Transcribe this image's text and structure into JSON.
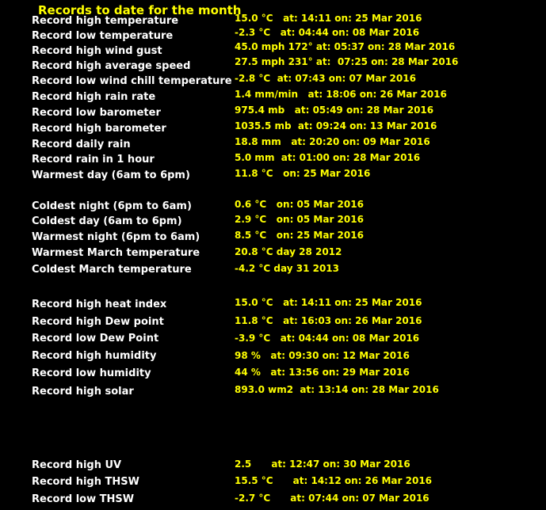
{
  "title": "Records to date for the month",
  "records": [
    {
      "label": "Record high temperature",
      "value": "15.0 °C   at: 14:11 on: 25 Mar 2016"
    },
    {
      "label": "Record low temperature",
      "value": "-2.3 °C   at: 04:44 on: 08 Mar 2016"
    },
    {
      "label": "Record high wind gust",
      "value": "45.0 mph 172° at: 05:37 on: 28 Mar 2016"
    },
    {
      "label": "Record high average speed",
      "value": "27.5 mph 231° at:  07:25 on: 28 Mar 2016"
    },
    {
      "label": "Record low wind chill temperature",
      "value": "-2.8 °C  at: 07:43 on: 07 Mar 2016"
    },
    {
      "label": "Record high rain rate",
      "value": "1.4 mm/min   at: 18:06 on: 26 Mar 2016"
    },
    {
      "label": "Record low barometer",
      "value": "975.4 mb   at: 05:49 on: 28 Mar 2016"
    },
    {
      "label": "Record high barometer",
      "value": "1035.5 mb  at: 09:24 on: 13 Mar 2016"
    },
    {
      "label": "Record daily rain",
      "value": "18.8 mm   at: 20:20 on: 09 Mar 2016"
    },
    {
      "label": "Record rain in 1 hour",
      "value": "5.0 mm  at: 01:00 on: 28 Mar 2016"
    },
    {
      "label": "Warmest day (6am to 6pm)",
      "value": "11.8 °C   on: 25 Mar 2016"
    },
    {
      "label": "Coldest night (6pm to 6am)",
      "value": "0.6 °C   on: 05 Mar 2016"
    },
    {
      "label": "Coldest day (6am to 6pm)",
      "value": "2.9 °C   on: 05 Mar 2016"
    },
    {
      "label": "Warmest night (6pm to 6am)",
      "value": "8.5 °C   on: 25 Mar 2016"
    },
    {
      "label": "Warmest March temperature",
      "value": "20.8 °C day 28 2012"
    },
    {
      "label": "Coldest March temperature",
      "value": "-4.2 °C day 31 2013"
    },
    {
      "label": "Record high heat index",
      "value": "15.0 °C   at: 14:11 on: 25 Mar 2016"
    },
    {
      "label": "Record high Dew point",
      "value": "11.8 °C   at: 16:03 on: 26 Mar 2016"
    },
    {
      "label": "Record low Dew Point",
      "value": "-3.9 °C   at: 04:44 on: 08 Mar 2016"
    },
    {
      "label": "Record high humidity",
      "value": "98 %   at: 09:30 on: 12 Mar 2016"
    },
    {
      "label": "Record low humidity",
      "value": "44 %   at: 13:56 on: 29 Mar 2016"
    },
    {
      "label": "Record high solar",
      "value": "893.0 wm2  at: 13:14 on: 28 Mar 2016"
    },
    {
      "label": "Record high UV",
      "value": "2.5      at: 12:47 on: 30 Mar 2016"
    },
    {
      "label": "Record high THSW",
      "value": "15.5 °C      at: 14:12 on: 26 Mar 2016"
    },
    {
      "label": "Record low THSW",
      "value": "-2.7 °C      at: 07:44 on: 07 Mar 2016"
    }
  ]
}
